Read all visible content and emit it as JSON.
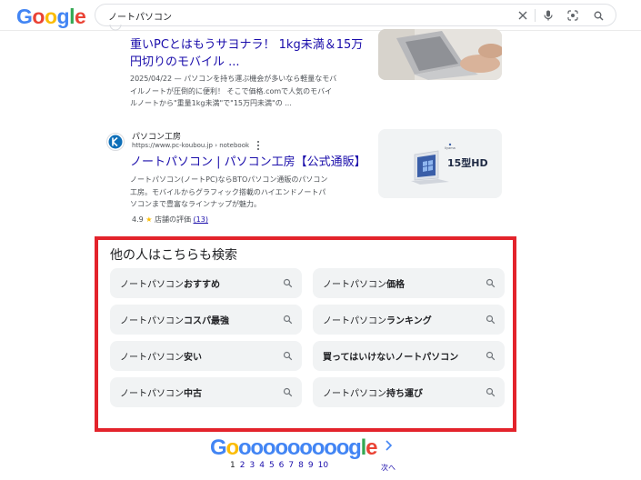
{
  "header": {
    "logo": "Google",
    "search_value": "ノートパソコン"
  },
  "result1": {
    "title_line1": "重いPCとはもうサヨナラ！ 1kg未満＆15万",
    "title_line2": "円切りのモバイル ...",
    "snippet_line1": "2025/04/22 — パソコンを持ち運ぶ機会が多いなら軽量なモバ",
    "snippet_line2": "イルノートが圧倒的に便利！ そこで価格.comで人気のモバイ",
    "snippet_line3": "ルノートから\"重量1kg未満\"で\"15万円未満\"の ..."
  },
  "result2": {
    "site_name": "パソコン工房",
    "site_url": "https://www.pc-koubou.jp › notebook",
    "title": "ノートパソコン | パソコン工房【公式通販】",
    "snippet_line1": "ノートパソコン(ノートPC)ならBTOパソコン通販のパソコン",
    "snippet_line2": "工房。モバイルからグラフィック搭載のハイエンドノートパ",
    "snippet_line3": "ソコンまで豊富なラインナップが魅力。",
    "rating_value": "4.9",
    "rating_label": "店舗の評価",
    "rating_count": "(13)",
    "thumb_text": "15型HD"
  },
  "people_also_search": {
    "title": "他の人はこちらも検索",
    "items": [
      {
        "prefix": "ノートパソコン ",
        "bold": "おすすめ"
      },
      {
        "prefix": "ノートパソコン ",
        "bold": "価格"
      },
      {
        "prefix": "ノートパソコン ",
        "bold": "コスパ最強"
      },
      {
        "prefix": "ノートパソコン ",
        "bold": "ランキング"
      },
      {
        "prefix": "ノートパソコン ",
        "bold": "安い"
      },
      {
        "prefix": "",
        "bold": "買ってはいけないノートパソコン"
      },
      {
        "prefix": "ノートパソコン ",
        "bold": "中古"
      },
      {
        "prefix": "ノートパソコン ",
        "bold": "持ち運び"
      }
    ]
  },
  "pagination": {
    "logo": "Goooooooooogle",
    "pages": [
      "1",
      "2",
      "3",
      "4",
      "5",
      "6",
      "7",
      "8",
      "9",
      "10"
    ],
    "current": "1",
    "next_label": "次へ"
  },
  "colors": {
    "link": "#1a0dab",
    "highlight_border": "#e3232b",
    "chip_bg": "#f1f3f4"
  }
}
